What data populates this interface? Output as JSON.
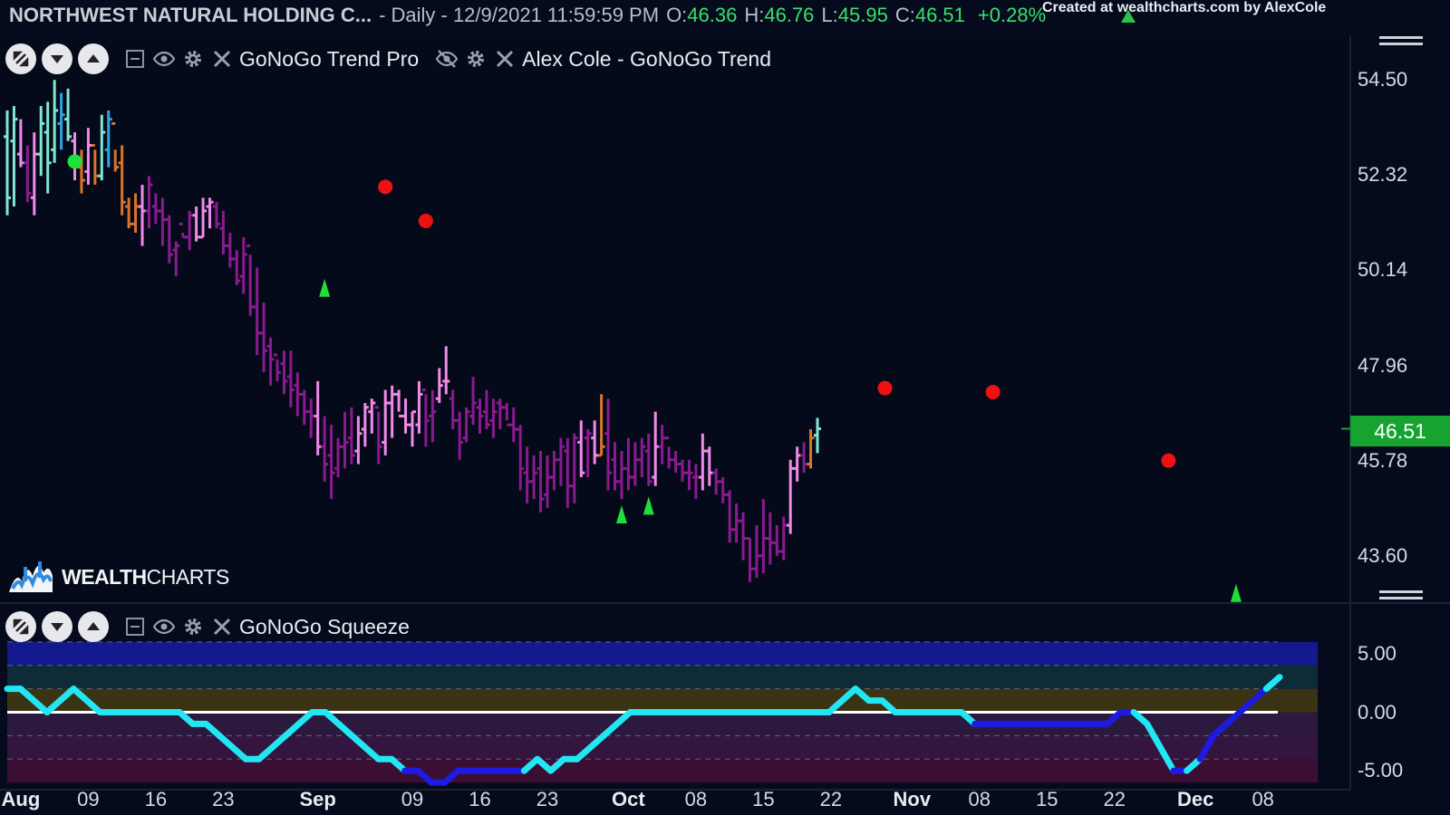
{
  "header": {
    "title": "NORTHWEST NATURAL HOLDING C...",
    "period": "- Daily - 12/9/2021 11:59:59 PM",
    "o_label": "O:",
    "o_value": "46.36",
    "h_label": "H:",
    "h_value": "46.76",
    "l_label": "L:",
    "l_value": "45.95",
    "c_label": "C:",
    "c_value": "46.51",
    "change": "+0.28%",
    "credit": "Created at wealthcharts.com by AlexCole"
  },
  "toolbar_top": {
    "indicator1": "GoNoGo Trend Pro",
    "indicator2": "Alex Cole - GoNoGo Trend"
  },
  "toolbar_bottom": {
    "indicator": "GoNoGo Squeeze"
  },
  "logo": {
    "brand_bold": "WEALTH",
    "brand_normal": "CHARTS"
  },
  "colors": {
    "background": "#050b1c",
    "aqua": "#7fe6d0",
    "blue": "#2aa6e8",
    "pink": "#f08ae8",
    "purple": "#8a1a8e",
    "amber": "#d9742a",
    "cyan": "#22e6f2",
    "deep_blue": "#1d1be0",
    "up_green": "#16a330"
  },
  "chart_data": [
    {
      "type": "ohlc",
      "ylim": [
        42.6,
        55.5
      ],
      "y_ticks": [
        "54.50",
        "52.32",
        "50.14",
        "47.96",
        "45.78",
        "43.60"
      ],
      "last_price": "46.51",
      "x_ticks": [
        {
          "label": "Aug",
          "bold": true,
          "i": 2
        },
        {
          "label": "09",
          "i": 7
        },
        {
          "label": "16",
          "i": 12
        },
        {
          "label": "23",
          "i": 17
        },
        {
          "label": "Sep",
          "bold": true,
          "i": 24
        },
        {
          "label": "09",
          "i": 31
        },
        {
          "label": "16",
          "i": 36
        },
        {
          "label": "23",
          "i": 41
        },
        {
          "label": "Oct",
          "bold": true,
          "i": 47
        },
        {
          "label": "08",
          "i": 52
        },
        {
          "label": "15",
          "i": 57
        },
        {
          "label": "22",
          "i": 62
        },
        {
          "label": "Nov",
          "bold": true,
          "i": 68
        },
        {
          "label": "08",
          "i": 73
        },
        {
          "label": "15",
          "i": 78
        },
        {
          "label": "22",
          "i": 83
        },
        {
          "label": "Dec",
          "bold": true,
          "i": 89
        },
        {
          "label": "08",
          "i": 94
        }
      ],
      "candles": [
        [
          "a",
          53.8,
          53.2,
          51.4,
          51.8
        ],
        [
          "a",
          53.9,
          53.1,
          51.6,
          53.6
        ],
        [
          "p",
          53.6,
          52.8,
          52.5,
          52.6
        ],
        [
          "i",
          53.0,
          52.6,
          51.7,
          51.9
        ],
        [
          "p",
          53.3,
          51.8,
          51.4,
          52.8
        ],
        [
          "q",
          53.9,
          52.8,
          52.3,
          53.5
        ],
        [
          "q",
          54.0,
          53.3,
          51.9,
          52.6
        ],
        [
          "q",
          54.5,
          52.9,
          52.6,
          53.8
        ],
        [
          "b",
          54.2,
          53.5,
          52.9,
          53.7
        ],
        [
          "q",
          54.3,
          53.6,
          53.1,
          53.2
        ],
        [
          "p",
          53.3,
          53.1,
          52.2,
          52.6
        ],
        [
          "o",
          52.9,
          52.5,
          51.9,
          52.2
        ],
        [
          "p",
          53.4,
          52.4,
          52.1,
          53.0
        ],
        [
          "o",
          52.9,
          53.0,
          52.1,
          52.3
        ],
        [
          "q",
          53.7,
          52.3,
          52.2,
          53.3
        ],
        [
          "b",
          53.8,
          52.9,
          52.5,
          53.6
        ],
        [
          "o",
          52.9,
          53.5,
          52.4,
          52.5
        ],
        [
          "o",
          53.0,
          52.6,
          51.4,
          51.7
        ],
        [
          "o",
          51.8,
          51.6,
          51.1,
          51.2
        ],
        [
          "o",
          51.9,
          51.2,
          51.0,
          51.6
        ],
        [
          "p",
          52.1,
          51.6,
          50.7,
          51.5
        ],
        [
          "i",
          52.3,
          51.5,
          51.1,
          52.1
        ],
        [
          "i",
          51.9,
          51.6,
          51.2,
          51.5
        ],
        [
          "i",
          51.8,
          51.5,
          50.7,
          51.3
        ],
        [
          "i",
          51.4,
          51.3,
          50.3,
          50.5
        ],
        [
          "i",
          50.8,
          50.6,
          50.0,
          50.7
        ],
        [
          "i",
          51.0,
          51.2,
          50.9,
          50.9
        ],
        [
          "i",
          51.5,
          50.9,
          50.6,
          51.4
        ],
        [
          "p",
          51.6,
          51.4,
          50.8,
          50.9
        ],
        [
          "p",
          51.8,
          50.9,
          50.9,
          51.5
        ],
        [
          "p",
          51.8,
          51.6,
          51.1,
          51.7
        ],
        [
          "i",
          51.7,
          51.6,
          51.1,
          51.2
        ],
        [
          "i",
          51.5,
          51.1,
          50.5,
          50.7
        ],
        [
          "i",
          51.0,
          50.7,
          50.2,
          50.4
        ],
        [
          "i",
          50.6,
          50.4,
          49.8,
          49.9
        ],
        [
          "i",
          50.9,
          50.0,
          49.6,
          50.5
        ],
        [
          "i",
          50.5,
          50.7,
          49.1,
          49.3
        ],
        [
          "i",
          50.2,
          49.3,
          48.2,
          48.7
        ],
        [
          "i",
          49.4,
          48.7,
          47.8,
          48.3
        ],
        [
          "i",
          48.6,
          48.4,
          47.5,
          48.1
        ],
        [
          "i",
          48.1,
          48.2,
          47.6,
          47.8
        ],
        [
          "i",
          48.3,
          48.0,
          47.3,
          47.6
        ],
        [
          "i",
          48.3,
          47.7,
          47.0,
          47.4
        ],
        [
          "i",
          47.8,
          47.5,
          46.8,
          47.3
        ],
        [
          "i",
          47.4,
          47.3,
          46.6,
          46.9
        ],
        [
          "i",
          47.2,
          46.9,
          46.3,
          46.8
        ],
        [
          "p",
          47.6,
          46.8,
          45.9,
          46.1
        ],
        [
          "i",
          46.8,
          46.1,
          45.3,
          45.7
        ],
        [
          "i",
          46.6,
          45.9,
          44.9,
          45.5
        ],
        [
          "i",
          46.3,
          45.6,
          45.4,
          46.1
        ],
        [
          "i",
          46.9,
          46.1,
          45.6,
          46.2
        ],
        [
          "i",
          47.0,
          46.3,
          45.7,
          45.9
        ],
        [
          "p",
          46.8,
          46.0,
          45.7,
          46.4
        ],
        [
          "p",
          47.1,
          46.5,
          46.1,
          47.0
        ],
        [
          "p",
          47.2,
          46.9,
          46.4,
          47.1
        ],
        [
          "i",
          46.9,
          47.0,
          45.7,
          46.1
        ],
        [
          "p",
          47.4,
          46.2,
          45.9,
          47.1
        ],
        [
          "p",
          47.5,
          47.1,
          46.3,
          47.3
        ],
        [
          "p",
          47.4,
          47.3,
          46.9,
          46.8
        ],
        [
          "p",
          47.2,
          46.8,
          46.4,
          46.6
        ],
        [
          "p",
          46.9,
          46.6,
          46.1,
          46.9
        ],
        [
          "p",
          47.6,
          46.6,
          46.4,
          47.3
        ],
        [
          "i",
          47.3,
          47.4,
          46.1,
          46.7
        ],
        [
          "i",
          47.4,
          46.8,
          46.2,
          46.9
        ],
        [
          "p",
          47.9,
          47.2,
          47.1,
          47.5
        ],
        [
          "p",
          48.4,
          47.6,
          47.3,
          47.6
        ],
        [
          "i",
          47.4,
          47.2,
          46.5,
          46.7
        ],
        [
          "i",
          46.9,
          46.7,
          45.8,
          46.2
        ],
        [
          "i",
          47.0,
          46.3,
          46.2,
          46.9
        ],
        [
          "i",
          47.7,
          46.8,
          46.6,
          47.1
        ],
        [
          "i",
          47.2,
          47.0,
          46.4,
          46.8
        ],
        [
          "i",
          47.4,
          46.9,
          46.5,
          46.6
        ],
        [
          "i",
          47.2,
          46.7,
          46.3,
          46.9
        ],
        [
          "i",
          47.2,
          47.1,
          46.5,
          47.0
        ],
        [
          "i",
          47.1,
          47.0,
          46.7,
          46.6
        ],
        [
          "i",
          47.0,
          46.6,
          46.2,
          46.5
        ],
        [
          "i",
          46.6,
          46.5,
          45.1,
          45.6
        ],
        [
          "i",
          46.1,
          45.5,
          44.8,
          45.3
        ],
        [
          "i",
          45.9,
          45.3,
          44.9,
          45.5
        ],
        [
          "i",
          46.0,
          45.6,
          44.6,
          44.9
        ],
        [
          "i",
          45.9,
          45.0,
          44.7,
          45.4
        ],
        [
          "i",
          46.0,
          45.4,
          45.1,
          45.8
        ],
        [
          "i",
          46.3,
          45.8,
          45.2,
          46.1
        ],
        [
          "i",
          46.3,
          46.0,
          44.7,
          45.2
        ],
        [
          "i",
          46.4,
          45.2,
          44.8,
          46.3
        ],
        [
          "p",
          46.7,
          46.2,
          45.4,
          45.5
        ],
        [
          "i",
          46.5,
          46.3,
          45.4,
          46.4
        ],
        [
          "p",
          46.7,
          46.3,
          45.7,
          45.9
        ],
        [
          "o",
          47.3,
          45.9,
          45.9,
          46.1
        ],
        [
          "i",
          47.2,
          46.4,
          45.1,
          45.5
        ],
        [
          "i",
          46.2,
          45.8,
          45.1,
          45.3
        ],
        [
          "i",
          46.0,
          45.3,
          44.9,
          45.6
        ],
        [
          "i",
          46.3,
          45.6,
          45.1,
          45.4
        ],
        [
          "i",
          46.2,
          45.4,
          45.2,
          45.8
        ],
        [
          "i",
          46.3,
          45.8,
          45.4,
          46.1
        ],
        [
          "i",
          46.4,
          46.0,
          45.2,
          45.3
        ],
        [
          "p",
          46.9,
          45.4,
          45.2,
          46.1
        ],
        [
          "i",
          46.6,
          46.1,
          45.7,
          46.3
        ],
        [
          "i",
          46.1,
          46.3,
          45.6,
          45.8
        ],
        [
          "i",
          46.0,
          45.8,
          45.5,
          45.7
        ],
        [
          "i",
          45.8,
          45.7,
          45.3,
          45.5
        ],
        [
          "i",
          45.8,
          45.5,
          45.1,
          45.5
        ],
        [
          "i",
          45.7,
          45.4,
          44.9,
          45.4
        ],
        [
          "p",
          46.4,
          45.4,
          45.1,
          46.0
        ],
        [
          "p",
          46.1,
          46.0,
          45.2,
          45.5
        ],
        [
          "i",
          45.6,
          45.5,
          45.0,
          45.3
        ],
        [
          "i",
          45.4,
          45.3,
          44.8,
          45.0
        ],
        [
          "i",
          45.1,
          45.0,
          43.9,
          44.2
        ],
        [
          "i",
          44.8,
          44.2,
          43.9,
          44.4
        ],
        [
          "i",
          44.6,
          44.4,
          43.5,
          44.0
        ],
        [
          "i",
          44.0,
          44.0,
          43.0,
          43.3
        ],
        [
          "i",
          44.3,
          43.3,
          43.1,
          43.6
        ],
        [
          "i",
          44.9,
          43.6,
          43.2,
          44.0
        ],
        [
          "i",
          44.6,
          44.0,
          43.4,
          43.9
        ],
        [
          "i",
          44.3,
          43.9,
          43.6,
          43.7
        ],
        [
          "i",
          44.5,
          43.7,
          43.5,
          44.3
        ],
        [
          "p",
          45.8,
          44.3,
          44.1,
          45.6
        ],
        [
          "p",
          46.1,
          45.6,
          45.3,
          45.9
        ],
        [
          "i",
          46.2,
          45.9,
          45.5,
          45.7
        ],
        [
          "o",
          46.5,
          45.7,
          45.6,
          46.3
        ],
        [
          "a",
          46.76,
          46.36,
          45.95,
          46.51
        ]
      ],
      "signals": {
        "green_dots": [
          {
            "i": 10,
            "y": 52.63
          }
        ],
        "red_dots": [
          {
            "i": 56,
            "y": 52.05
          },
          {
            "i": 62,
            "y": 51.27
          },
          {
            "i": 130,
            "y": 47.44
          },
          {
            "i": 146,
            "y": 47.35
          },
          {
            "i": 172,
            "y": 45.78
          }
        ],
        "green_triangles": [
          {
            "i": 47,
            "y": 49.74
          },
          {
            "i": 91,
            "y": 44.55
          },
          {
            "i": 95,
            "y": 44.75
          },
          {
            "i": 182,
            "y": 42.75
          }
        ]
      }
    },
    {
      "type": "line",
      "name": "GoNoGo Squeeze",
      "ylim": [
        -6.3,
        6.3
      ],
      "y_ticks": [
        "5.00",
        "0.00",
        "-5.00"
      ],
      "bands": [
        {
          "from": 4,
          "to": 6,
          "color": "#141a8e"
        },
        {
          "from": 2,
          "to": 4,
          "color": "#0e2c38"
        },
        {
          "from": 0,
          "to": 2,
          "color": "#3a3314"
        },
        {
          "from": -2,
          "to": 0,
          "color": "#2c1a3e"
        },
        {
          "from": -4,
          "to": -2,
          "color": "#331540"
        },
        {
          "from": -6,
          "to": -4,
          "color": "#3b0e34"
        }
      ],
      "zero_line": 0,
      "values": [
        2,
        2,
        1,
        0,
        1,
        2,
        1,
        0,
        0,
        0,
        0,
        0,
        0,
        0,
        -1,
        -1,
        -2,
        -3,
        -4,
        -4,
        -3,
        -2,
        -1,
        0,
        0,
        -1,
        -2,
        -3,
        -4,
        -4,
        -5,
        -5,
        -6,
        -6,
        -5,
        -5,
        -5,
        -5,
        -5,
        -5,
        -4,
        -5,
        -4,
        -4,
        -3,
        -2,
        -1,
        0,
        0,
        0,
        0,
        0,
        0,
        0,
        0,
        0,
        0,
        0,
        0,
        0,
        0,
        0,
        0,
        1,
        2,
        1,
        1,
        0,
        0,
        0,
        0,
        0,
        0,
        -1,
        -1,
        -1,
        -1,
        -1,
        -1,
        -1,
        -1,
        -1,
        -1,
        -1,
        0,
        0,
        -1,
        -3,
        -5,
        -5,
        -4,
        -2,
        -1,
        0,
        1,
        2,
        3
      ]
    }
  ]
}
